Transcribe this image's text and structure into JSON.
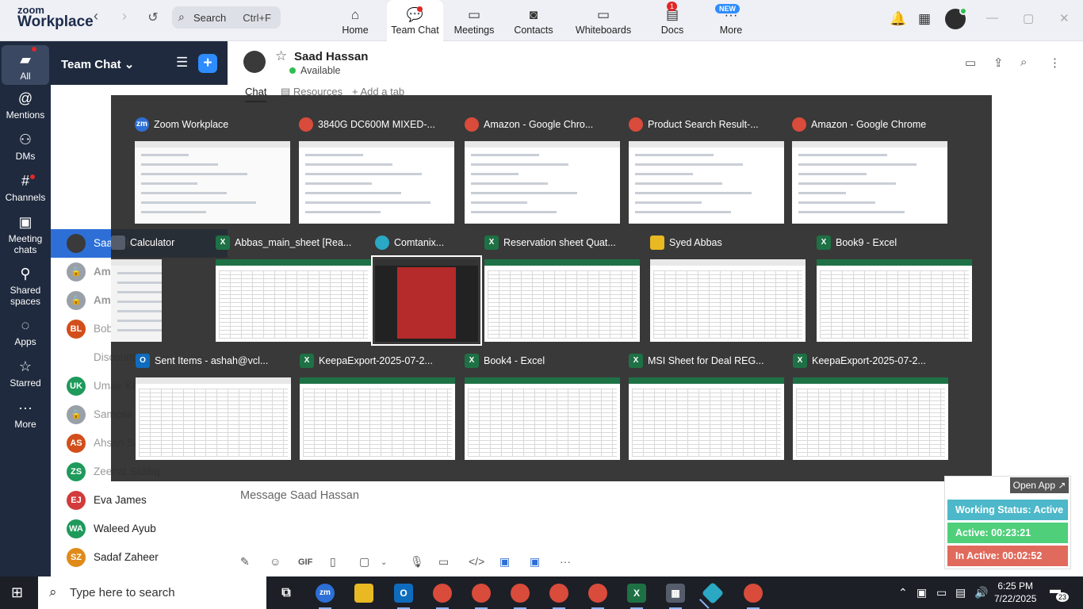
{
  "app": {
    "logo_line1": "zoom",
    "logo_line2": "Workplace"
  },
  "topbar": {
    "search_label": "Search",
    "search_shortcut": "Ctrl+F",
    "tabs": [
      {
        "label": "Home",
        "icon": "home-icon"
      },
      {
        "label": "Team Chat",
        "icon": "chat-icon",
        "active": true
      },
      {
        "label": "Meetings",
        "icon": "video-icon"
      },
      {
        "label": "Contacts",
        "icon": "contacts-icon"
      },
      {
        "label": "Whiteboards",
        "icon": "whiteboard-icon"
      },
      {
        "label": "Docs",
        "icon": "docs-icon",
        "badge": "1"
      },
      {
        "label": "More",
        "icon": "more-icon",
        "new_badge": "NEW"
      }
    ]
  },
  "rail": {
    "items": [
      {
        "label": "All",
        "active": true
      },
      {
        "label": "Mentions"
      },
      {
        "label": "DMs"
      },
      {
        "label": "Channels"
      },
      {
        "label": "Meeting chats"
      },
      {
        "label": "Shared spaces"
      },
      {
        "label": "Apps"
      },
      {
        "label": "Starred"
      },
      {
        "label": "More"
      }
    ]
  },
  "sidebar": {
    "title": "Team Chat",
    "items": [
      {
        "label": "Saad Hassan",
        "initials": "",
        "color": "#3a3a3a",
        "selected": true
      },
      {
        "label": "Amazon",
        "initials": "",
        "color": "#9aa0a8"
      },
      {
        "label": "Amazon",
        "initials": "",
        "color": "#9aa0a8"
      },
      {
        "label": "Bob Lyo",
        "initials": "BL",
        "color": "#d24e1a"
      },
      {
        "label": "Discount",
        "initials": "",
        "color": "#9aa0a8"
      },
      {
        "label": "Umair Kh",
        "initials": "UK",
        "color": "#1e9a5b"
      },
      {
        "label": "Samosa",
        "initials": "",
        "color": "#9aa0a8"
      },
      {
        "label": "Ahsan Sa",
        "initials": "AS",
        "color": "#d24e1a"
      },
      {
        "label": "Zeenat Siddiq",
        "initials": "ZS",
        "color": "#1e9a5b"
      },
      {
        "label": "Eva James",
        "initials": "EJ",
        "color": "#d23b3b"
      },
      {
        "label": "Waleed Ayub",
        "initials": "WA",
        "color": "#1e9a5b"
      },
      {
        "label": "Sadaf Zaheer",
        "initials": "SZ",
        "color": "#e08a1a"
      }
    ]
  },
  "chat": {
    "contact_name": "Saad Hassan",
    "status": "Available",
    "tabs": [
      "Chat",
      "Resources",
      "Add a tab"
    ],
    "message_placeholder": "Message Saad Hassan",
    "toolbar": {
      "gif": "GIF"
    }
  },
  "task_switcher": {
    "windows": [
      {
        "title": "Zoom Workplace",
        "icon": "zoom-icon",
        "color": "#2d6fd6",
        "glyph": "zm"
      },
      {
        "title": "3840G DC600M MIXED-...",
        "icon": "chrome-icon",
        "color": "#d94b3b"
      },
      {
        "title": "Amazon - Google Chro...",
        "icon": "chrome-icon",
        "color": "#d94b3b"
      },
      {
        "title": "Product Search Result-...",
        "icon": "chrome-icon",
        "color": "#d94b3b"
      },
      {
        "title": "Amazon - Google Chrome",
        "icon": "chrome-icon",
        "color": "#d94b3b"
      },
      {
        "title": "Calculator",
        "icon": "calculator-icon",
        "color": "#555d6b"
      },
      {
        "title": "Abbas_main_sheet  [Rea...",
        "icon": "excel-icon",
        "color": "#1e7145",
        "glyph": "X"
      },
      {
        "title": "Comtanix...",
        "icon": "comtanix-icon",
        "color": "#2aa8c4",
        "selected": true
      },
      {
        "title": "Reservation sheet Quat...",
        "icon": "excel-icon",
        "color": "#1e7145",
        "glyph": "X"
      },
      {
        "title": "Syed Abbas",
        "icon": "folder-icon",
        "color": "#e8b923"
      },
      {
        "title": "Book9 - Excel",
        "icon": "excel-icon",
        "color": "#1e7145",
        "glyph": "X"
      },
      {
        "title": "Sent Items - ashah@vcl...",
        "icon": "outlook-icon",
        "color": "#0f6cbd",
        "glyph": "O"
      },
      {
        "title": "KeepaExport-2025-07-2...",
        "icon": "excel-icon",
        "color": "#1e7145",
        "glyph": "X"
      },
      {
        "title": "Book4 - Excel",
        "icon": "excel-icon",
        "color": "#1e7145",
        "glyph": "X"
      },
      {
        "title": "MSI Sheet for Deal REG...",
        "icon": "excel-icon",
        "color": "#1e7145",
        "glyph": "X"
      },
      {
        "title": "KeepaExport-2025-07-2...",
        "icon": "excel-icon",
        "color": "#1e7145",
        "glyph": "X"
      }
    ]
  },
  "status_panel": {
    "open_app": "Open App ↗",
    "working_status": "Working Status: Active",
    "active_time": "Active: 00:23:21",
    "inactive_time": "In Active: 00:02:52"
  },
  "taskbar": {
    "search_placeholder": "Type here to search",
    "time": "6:25 PM",
    "date": "7/22/2025",
    "notification_count": "23"
  }
}
